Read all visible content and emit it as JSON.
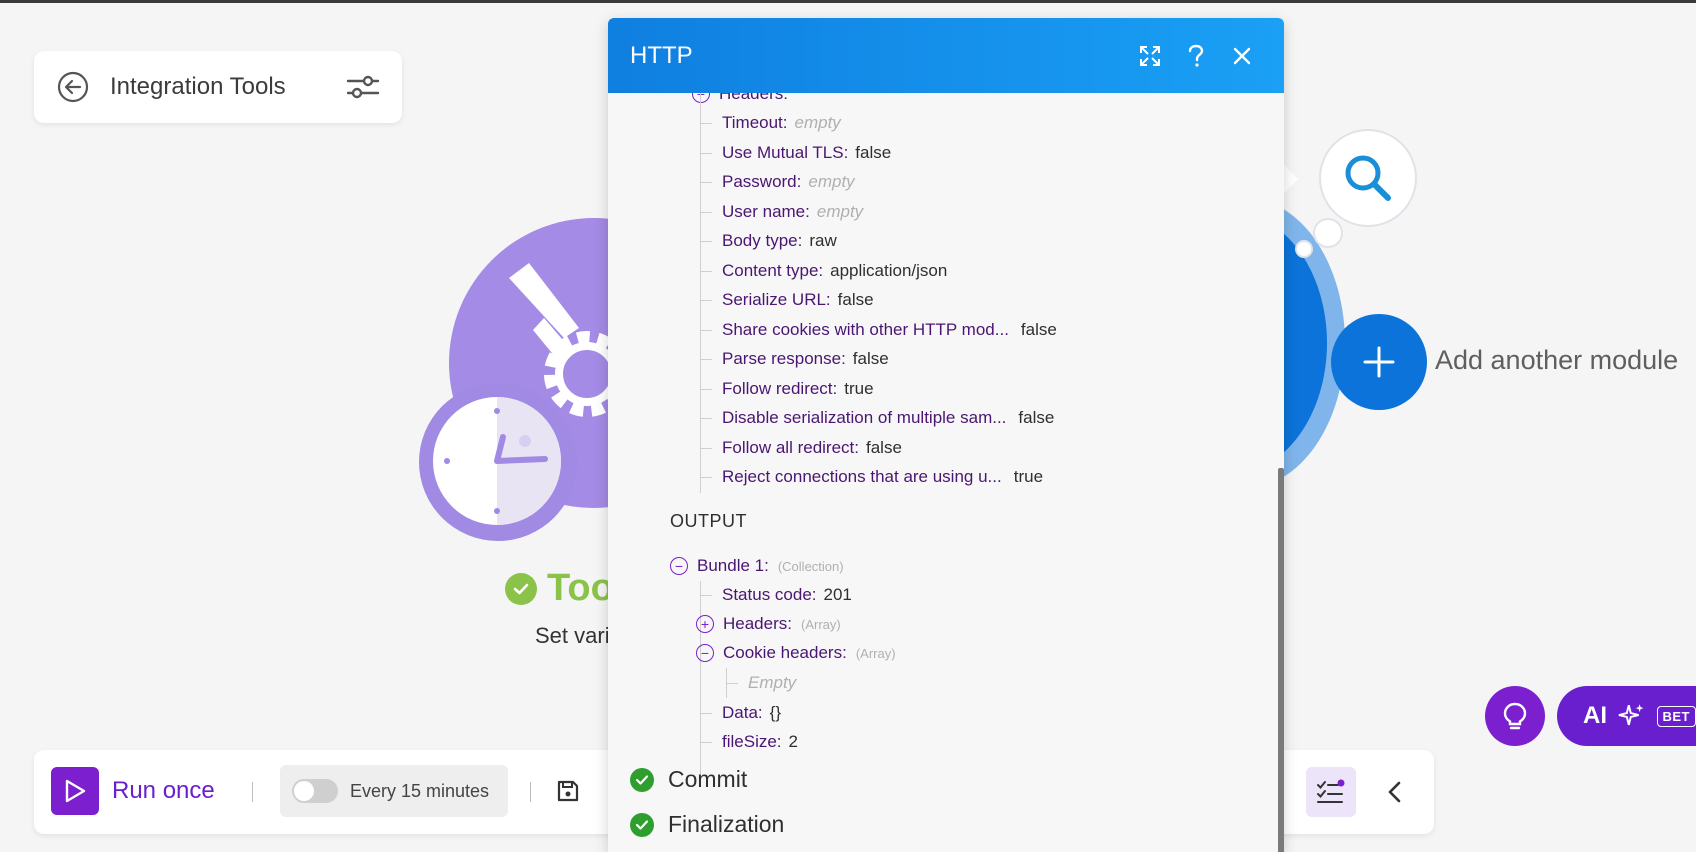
{
  "scenario": {
    "title": "Integration Tools"
  },
  "background_module": {
    "name": "Too",
    "subtitle": "Set vari"
  },
  "canvas": {
    "add_module_label": "Add another module"
  },
  "assistant": {
    "ai_label": "AI",
    "beta_label": "BET"
  },
  "toolbar": {
    "run_label": "Run once",
    "schedule_label": "Every 15 minutes"
  },
  "dialog": {
    "title": "HTTP",
    "headers_partial_label": "Headers:",
    "input_items": [
      {
        "key": "Timeout:",
        "value": "empty",
        "empty": true
      },
      {
        "key": "Use Mutual TLS:",
        "value": "false"
      },
      {
        "key": "Password:",
        "value": "empty",
        "empty": true
      },
      {
        "key": "User name:",
        "value": "empty",
        "empty": true
      },
      {
        "key": "Body type:",
        "value": "raw"
      },
      {
        "key": "Content type:",
        "value": "application/json"
      },
      {
        "key": "Serialize URL:",
        "value": "false"
      },
      {
        "key": "Share cookies with other HTTP mod...",
        "value": "false"
      },
      {
        "key": "Parse response:",
        "value": "false"
      },
      {
        "key": "Follow redirect:",
        "value": "true"
      },
      {
        "key": "Disable serialization of multiple sam...",
        "value": "false"
      },
      {
        "key": "Follow all redirect:",
        "value": "false"
      },
      {
        "key": "Reject connections that are using u...",
        "value": "true"
      }
    ],
    "output_label": "OUTPUT",
    "bundle": {
      "key": "Bundle 1:",
      "type": "(Collection)"
    },
    "status_code": {
      "key": "Status code:",
      "value": "201"
    },
    "headers": {
      "key": "Headers:",
      "type": "(Array)"
    },
    "cookie_headers": {
      "key": "Cookie headers:",
      "type": "(Array)",
      "empty_text": "Empty"
    },
    "data_item": {
      "key": "Data:",
      "value": "{}"
    },
    "file_size": {
      "key": "fileSize:",
      "value": "2"
    },
    "phases": [
      "Commit",
      "Finalization"
    ]
  },
  "colors": {
    "accent": "#7b1fcf",
    "dialog_header": "#1a8ff0",
    "success": "#2e9e2e",
    "module_purple": "#a48be6",
    "http_blue": "#0b73d9"
  }
}
